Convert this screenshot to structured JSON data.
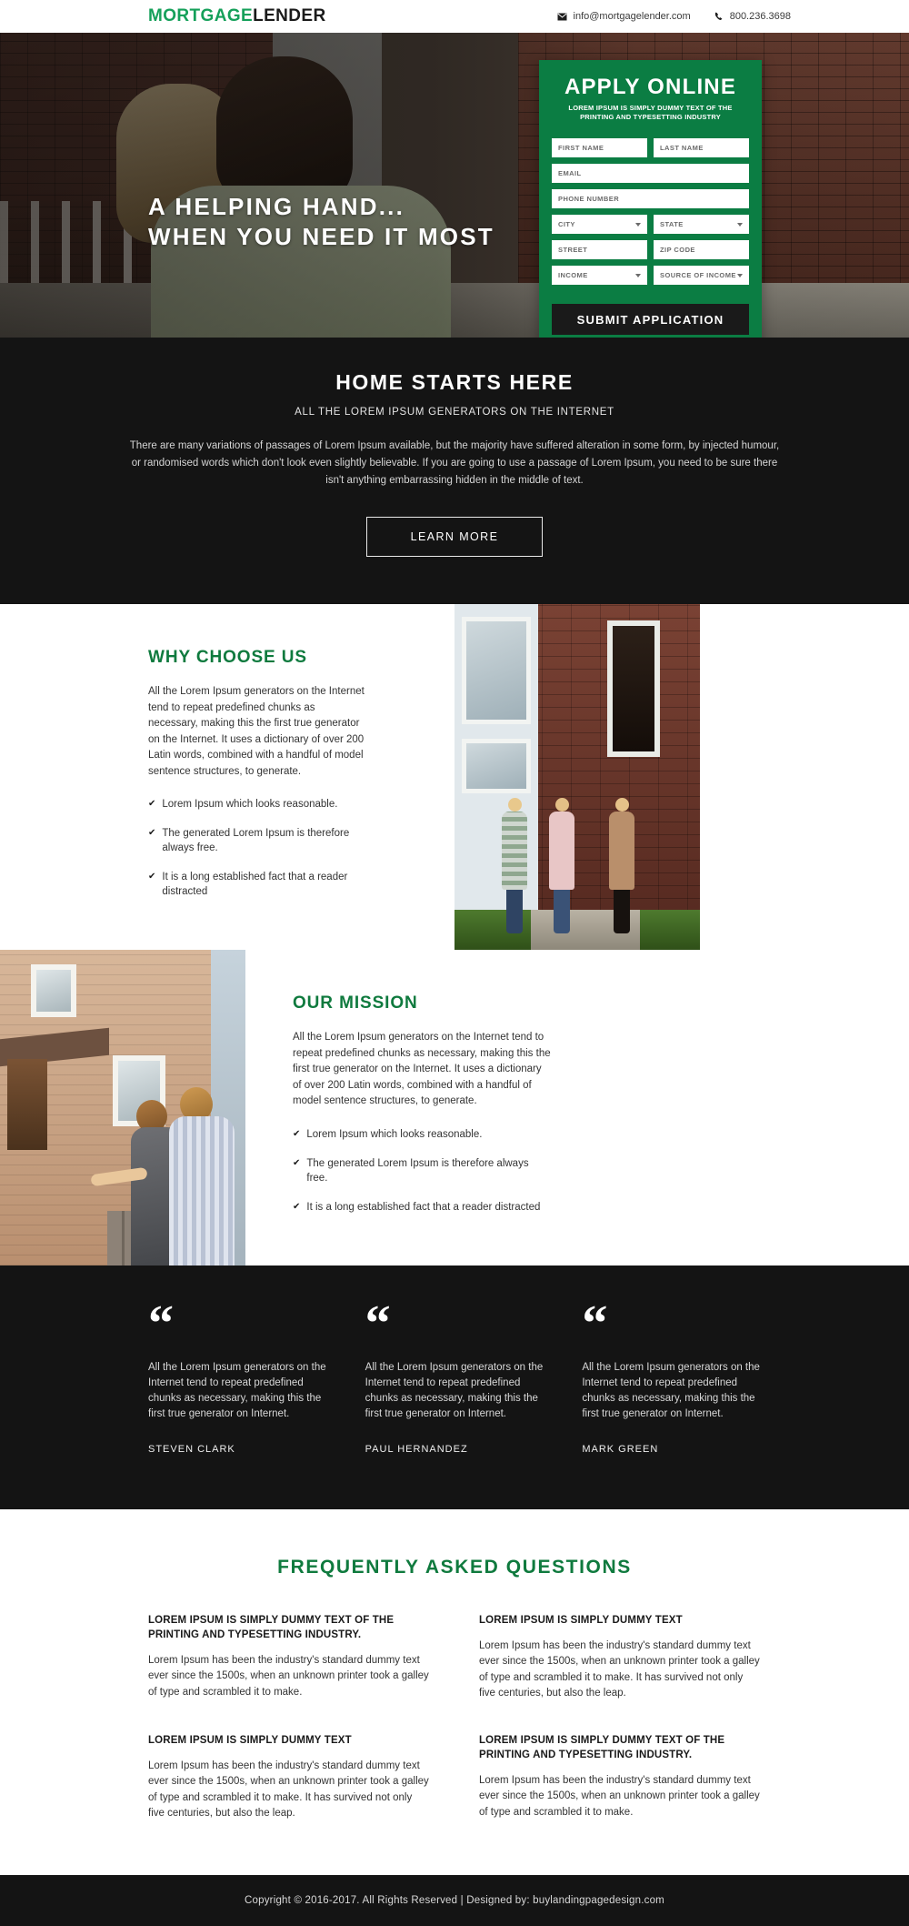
{
  "header": {
    "logo_primary": "MORTGAGE",
    "logo_secondary": "LENDER",
    "email": "info@mortgagelender.com",
    "phone": "800.236.3698",
    "email_icon": "envelope-icon",
    "phone_icon": "phone-icon"
  },
  "hero": {
    "headline_line1": "A HELPING HAND...",
    "headline_line2": "WHEN YOU NEED IT MOST"
  },
  "apply_form": {
    "title": "APPLY ONLINE",
    "subtitle_line1": "LOREM IPSUM IS SIMPLY DUMMY TEXT OF THE",
    "subtitle_line2": "PRINTING AND TYPESETTING INDUSTRY",
    "fields": [
      {
        "label": "FIRST NAME",
        "type": "text"
      },
      {
        "label": "LAST NAME",
        "type": "text"
      },
      {
        "label": "EMAIL",
        "type": "text"
      },
      {
        "label": "PHONE NUMBER",
        "type": "text"
      },
      {
        "label": "CITY",
        "type": "select"
      },
      {
        "label": "STATE",
        "type": "select"
      },
      {
        "label": "STREET",
        "type": "text"
      },
      {
        "label": "ZIP CODE",
        "type": "text"
      },
      {
        "label": "INCOME",
        "type": "select"
      },
      {
        "label": "SOURCE OF INCOME",
        "type": "select"
      }
    ],
    "submit_label": "SUBMIT APPLICATION",
    "accent_color": "#0b7d43",
    "submit_color": "#1a1a1a"
  },
  "intro": {
    "title": "HOME STARTS HERE",
    "subtitle": "ALL THE LOREM IPSUM GENERATORS ON THE INTERNET",
    "body": "There are many variations of passages of Lorem Ipsum available, but the majority have suffered alteration in some form, by injected humour, or randomised words which don't look even slightly believable. If you are going to use a passage of Lorem Ipsum, you need to be sure there isn't anything embarrassing hidden in the middle of text.",
    "button_label": "LEARN MORE"
  },
  "features": [
    {
      "title": "WHY CHOOSE US",
      "body": "All the Lorem Ipsum generators on the Internet tend to repeat predefined chunks as necessary, making this the first true generator on the Internet. It uses a dictionary of over 200 Latin words, combined with a handful of model sentence structures, to generate.",
      "bullets": [
        "Lorem Ipsum which looks reasonable.",
        "The generated Lorem Ipsum is therefore always free.",
        "It is a long established fact that a reader distracted"
      ],
      "image_name": "family-receiving-keys-photo"
    },
    {
      "title": "OUR MISSION",
      "body": "All the Lorem Ipsum generators on the Internet tend to repeat predefined chunks as necessary, making this the first true generator on the Internet. It uses a dictionary of over 200 Latin words, combined with a handful of model sentence structures, to generate.",
      "bullets": [
        "Lorem Ipsum which looks reasonable.",
        "The generated Lorem Ipsum is therefore always free.",
        "It is a long established fact that a reader distracted"
      ],
      "image_name": "couple-pointing-at-house-photo"
    }
  ],
  "testimonials": [
    {
      "quote_mark": "“",
      "text": "All the Lorem Ipsum generators on the Internet tend to repeat predefined chunks as necessary, making this the first true generator on Internet.",
      "name": "STEVEN CLARK"
    },
    {
      "quote_mark": "“",
      "text": "All the Lorem Ipsum generators on the Internet tend to repeat predefined chunks as necessary, making this the first true generator on Internet.",
      "name": "PAUL HERNANDEZ"
    },
    {
      "quote_mark": "“",
      "text": "All the Lorem Ipsum generators on the Internet tend to repeat predefined chunks as necessary, making this the first true generator on Internet.",
      "name": "MARK GREEN"
    }
  ],
  "faq": {
    "title": "FREQUENTLY ASKED QUESTIONS",
    "items": [
      {
        "question": "LOREM IPSUM IS SIMPLY DUMMY TEXT OF THE PRINTING AND TYPESETTING INDUSTRY.",
        "answer": "Lorem Ipsum has been the industry's standard dummy text ever since the 1500s, when an unknown printer took a galley of type and scrambled it to make."
      },
      {
        "question": "LOREM IPSUM IS SIMPLY DUMMY TEXT",
        "answer": "Lorem Ipsum has been the industry's standard dummy text ever since the 1500s, when an unknown printer took a galley of type and scrambled it to make. It has survived not only five centuries, but also the leap."
      },
      {
        "question": "LOREM IPSUM IS SIMPLY DUMMY TEXT",
        "answer": "Lorem Ipsum has been the industry's standard dummy text ever since the 1500s, when an unknown printer took a galley of type and scrambled it to make. It has survived not only five centuries, but also the leap."
      },
      {
        "question": "LOREM IPSUM IS SIMPLY DUMMY TEXT OF THE PRINTING AND TYPESETTING INDUSTRY.",
        "answer": "Lorem Ipsum has been the industry's standard dummy text ever since the 1500s, when an unknown printer took a galley of type and scrambled it to make."
      }
    ]
  },
  "footer": {
    "text": "Copyright © 2016-2017. All Rights Reserved  |  Designed by: buylandingpagedesign.com"
  },
  "colors": {
    "brand_green": "#15a05a",
    "heading_green": "#0f7a3e",
    "form_green": "#0b7d43",
    "dark": "#141414"
  }
}
